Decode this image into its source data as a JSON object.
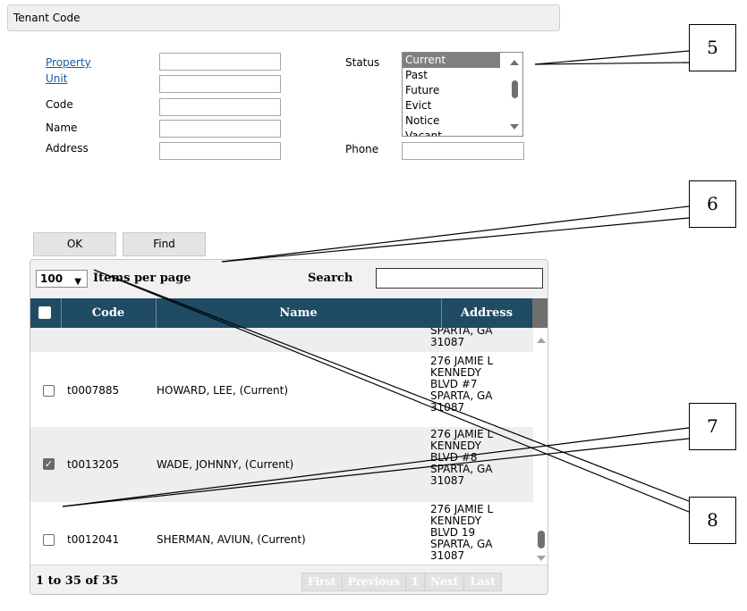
{
  "window": {
    "title": "Tenant Code"
  },
  "form": {
    "property_label": "Property",
    "unit_label": "Unit",
    "code_label": "Code",
    "name_label": "Name",
    "address_label": "Address",
    "status_label": "Status",
    "phone_label": "Phone",
    "property_value": "",
    "unit_value": "",
    "code_value": "",
    "name_value": "",
    "address_value": "",
    "phone_value": "",
    "status_options": [
      "Current",
      "Past",
      "Future",
      "Evict",
      "Notice",
      "Vacant"
    ],
    "status_selected": "Current"
  },
  "buttons": {
    "ok_label": "OK",
    "find_label": "Find"
  },
  "grid": {
    "page_size": "100",
    "items_per_page_label": "Items per page",
    "search_label": "Search",
    "search_value": "",
    "columns": {
      "code": "Code",
      "name": "Name",
      "address": "Address"
    },
    "rows": [
      {
        "code": "",
        "name": "",
        "address": "SPARTA, GA\n31087",
        "checked": false,
        "partial": true
      },
      {
        "code": "t0007885",
        "name": "HOWARD, LEE, (Current)",
        "address": "276 JAMIE L\nKENNEDY\nBLVD #7\nSPARTA, GA\n31087",
        "checked": false
      },
      {
        "code": "t0013205",
        "name": "WADE, JOHNNY, (Current)",
        "address": "276 JAMIE L\nKENNEDY\nBLVD #8\nSPARTA, GA\n31087",
        "checked": true
      },
      {
        "code": "t0012041",
        "name": "SHERMAN, AVIUN, (Current)",
        "address": "276 JAMIE L\nKENNEDY\nBLVD 19\nSPARTA, GA\n31087",
        "checked": false
      }
    ],
    "count_text": "1 to 35 of 35",
    "pager": {
      "first": "First",
      "previous": "Previous",
      "current": "1",
      "next": "Next",
      "last": "Last"
    }
  },
  "callouts": [
    "5",
    "6",
    "7",
    "8"
  ]
}
